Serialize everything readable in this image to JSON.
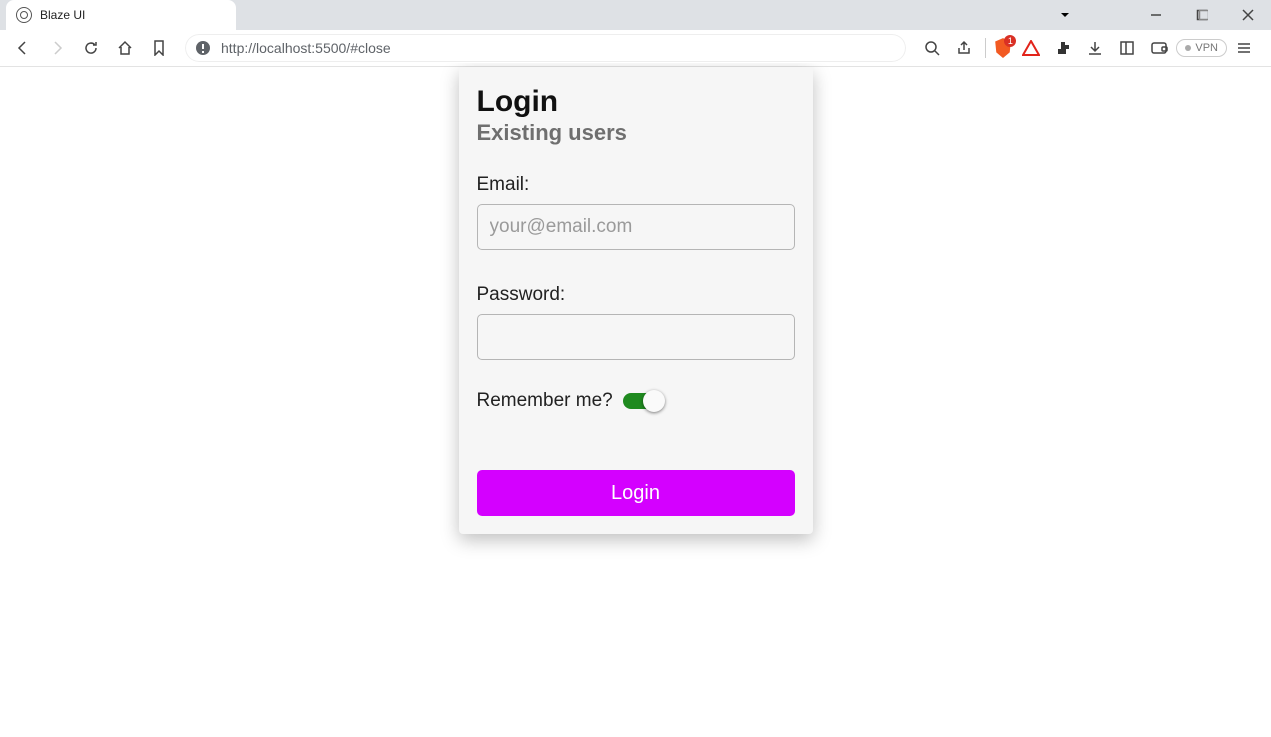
{
  "browser": {
    "tab_title": "Blaze UI",
    "url": "http://localhost:5500/#close",
    "shield_count": "1",
    "vpn_label": "VPN"
  },
  "card": {
    "title": "Login",
    "subtitle": "Existing users",
    "email_label": "Email:",
    "email_placeholder": "your@email.com",
    "email_value": "",
    "password_label": "Password:",
    "password_value": "",
    "remember_label": "Remember me?",
    "remember_on": true,
    "submit_label": "Login"
  }
}
